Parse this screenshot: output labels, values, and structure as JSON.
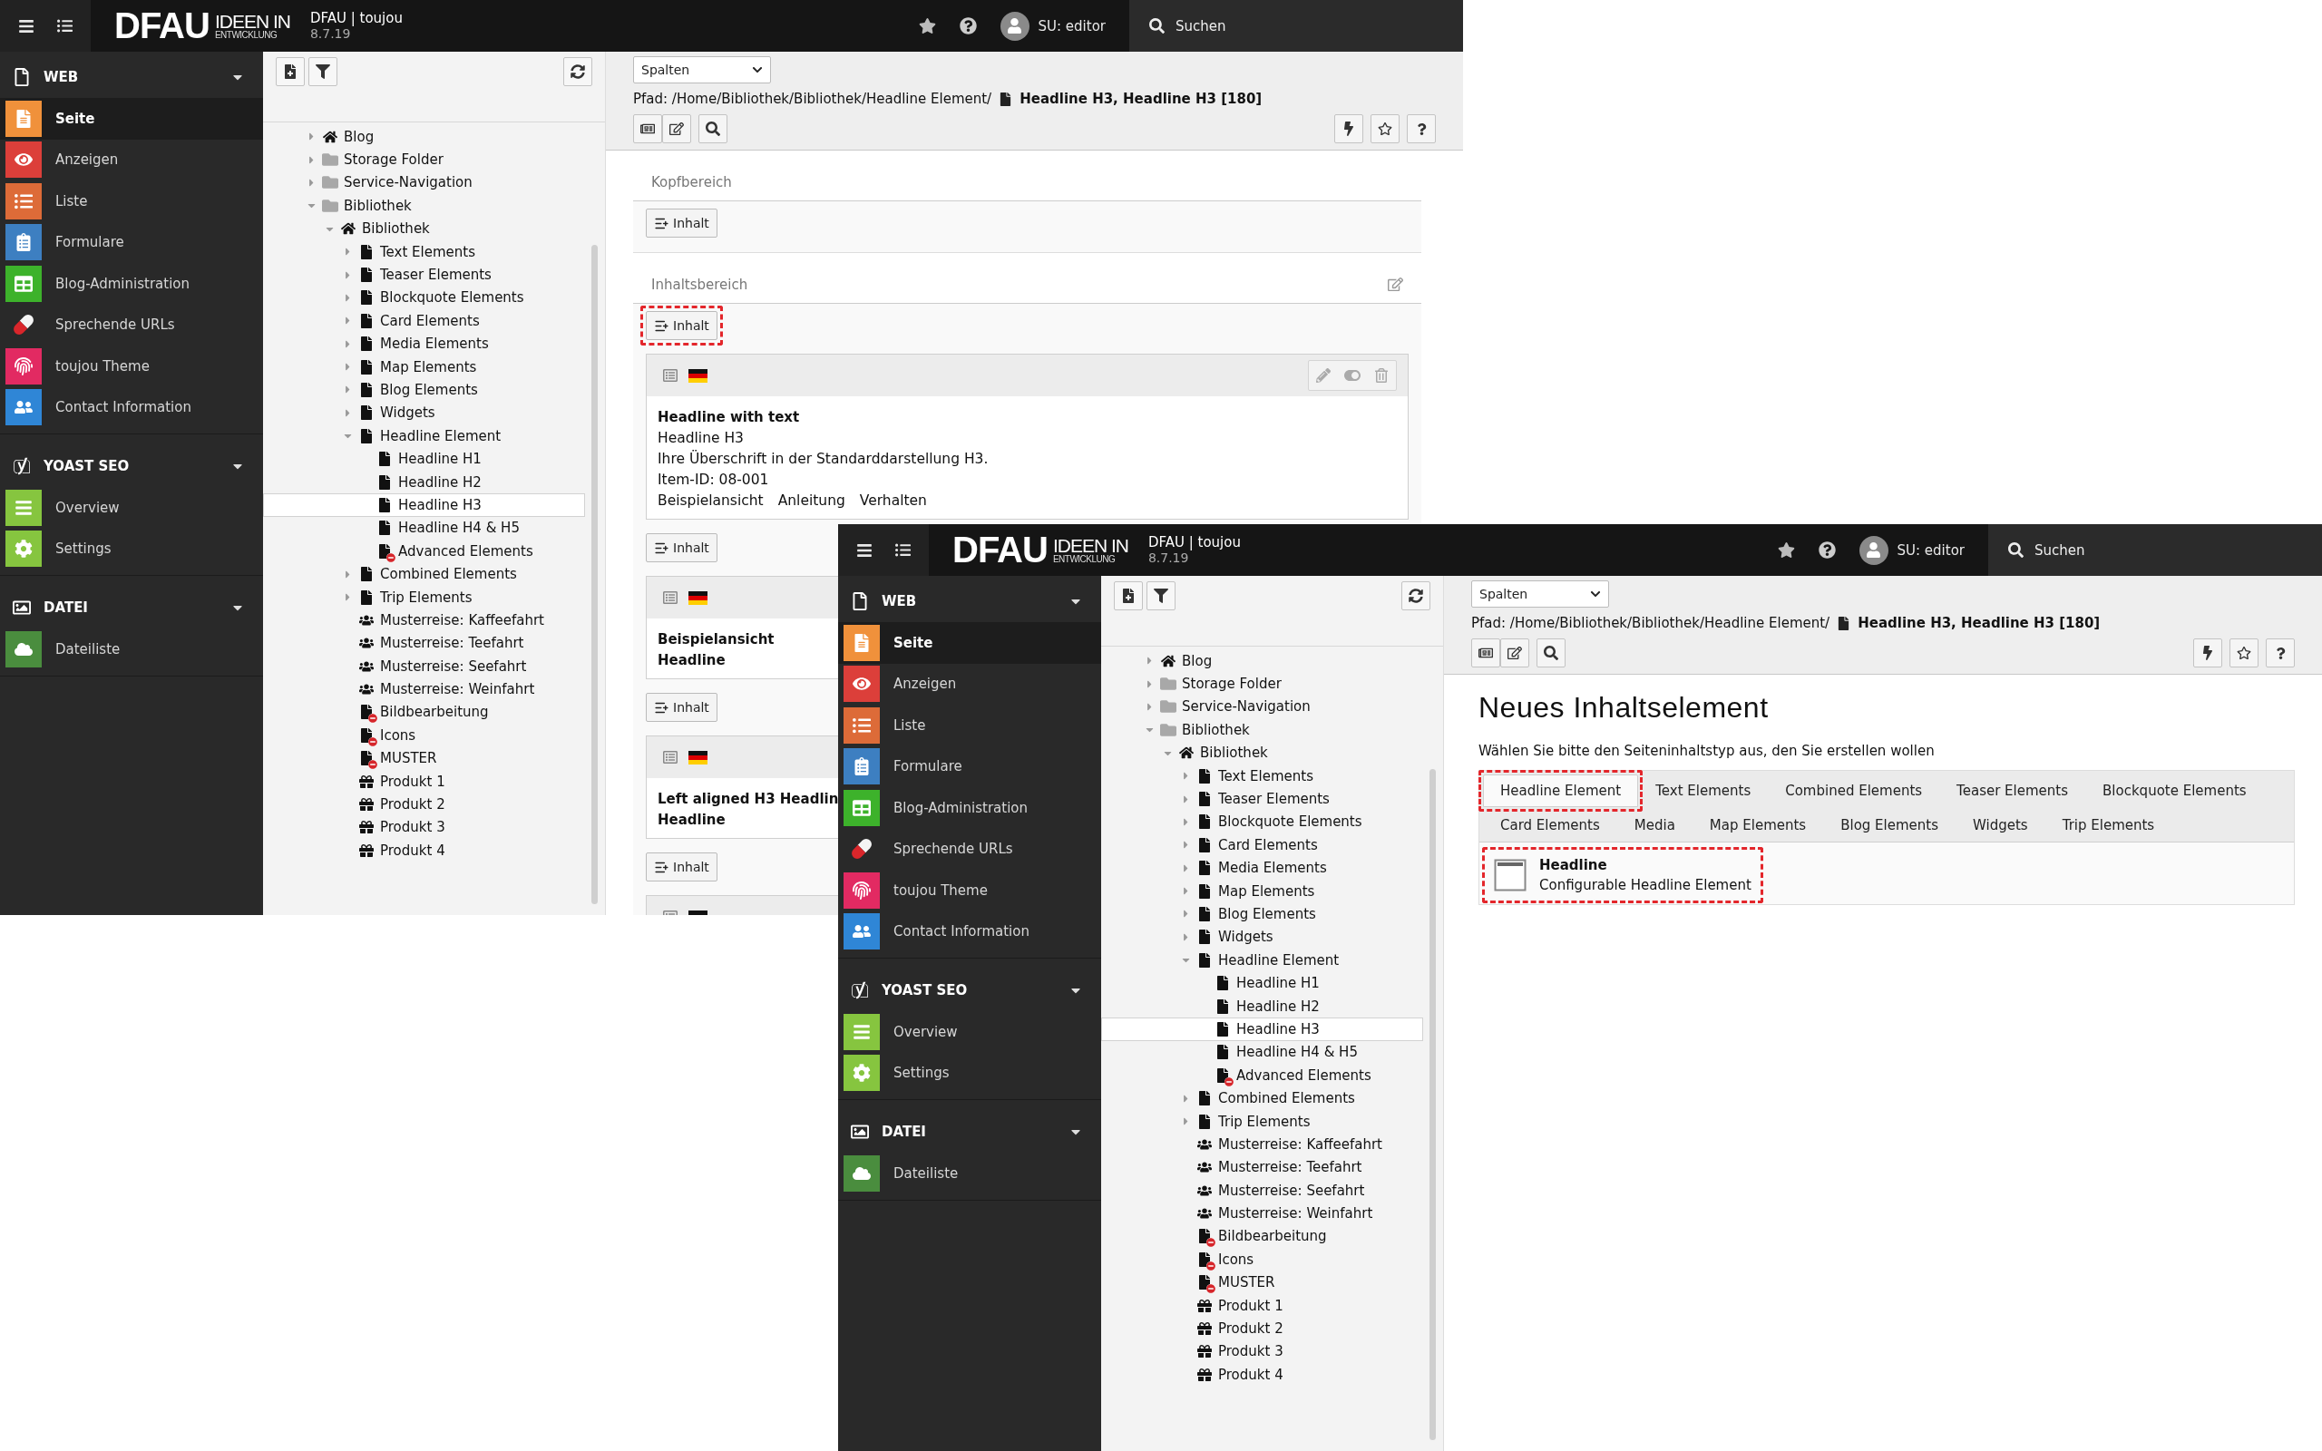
{
  "windows": [
    {
      "topbar": {
        "logo_main": "DFAU",
        "logo_top": "IDEEN IN",
        "logo_bottom": "ENTWICKLUNG",
        "site": "DFAU | toujou",
        "version": "8.7.19",
        "user": "SU: editor",
        "search": "Suchen"
      },
      "modules": [
        {
          "label": "WEB",
          "kind": "web",
          "expanded": true,
          "items": [
            {
              "label": "Seite",
              "kind": "page",
              "color": "#f0913b",
              "selected": true
            },
            {
              "label": "Anzeigen",
              "kind": "view",
              "color": "#dc3f3a",
              "selected": false
            },
            {
              "label": "Liste",
              "kind": "list",
              "color": "#dd6b38",
              "selected": false
            },
            {
              "label": "Formulare",
              "kind": "form",
              "color": "#3d7fc1",
              "selected": false
            },
            {
              "label": "Blog-Administration",
              "kind": "table",
              "color": "#3db22b",
              "selected": false
            },
            {
              "label": "Sprechende URLs",
              "kind": "pill",
              "selected": false
            },
            {
              "label": "toujou Theme",
              "kind": "fingerprint",
              "color": "#e22a62",
              "selected": false
            },
            {
              "label": "Contact Information",
              "kind": "contact",
              "color": "#2f86d6",
              "selected": false
            }
          ]
        },
        {
          "label": "YOAST SEO",
          "kind": "seo",
          "expanded": true,
          "items": [
            {
              "label": "Overview",
              "kind": "menu",
              "color": "#86c53f",
              "selected": false
            },
            {
              "label": "Settings",
              "kind": "gear",
              "color": "#86c53f",
              "selected": false
            }
          ]
        },
        {
          "label": "DATEI",
          "kind": "file",
          "expanded": true,
          "items": [
            {
              "label": "Dateiliste",
              "kind": "cloud",
              "color": "#4a8d3e",
              "selected": false
            }
          ]
        }
      ],
      "tree": [
        {
          "label": "Blog",
          "kind": "home",
          "expanded": false,
          "selected": false
        },
        {
          "label": "Storage Folder",
          "kind": "folder",
          "expanded": false,
          "selected": false
        },
        {
          "label": "Service-Navigation",
          "kind": "folder",
          "expanded": false,
          "selected": false
        },
        {
          "label": "Bibliothek",
          "kind": "folder",
          "expanded": true,
          "selected": false,
          "children": [
            {
              "label": "Bibliothek",
              "kind": "home",
              "expanded": true,
              "selected": false,
              "children": [
                {
                  "label": "Text Elements",
                  "kind": "page",
                  "expanded": false,
                  "selected": false
                },
                {
                  "label": "Teaser Elements",
                  "kind": "page",
                  "expanded": false,
                  "selected": false
                },
                {
                  "label": "Blockquote Elements",
                  "kind": "page",
                  "expanded": false,
                  "selected": false
                },
                {
                  "label": "Card Elements",
                  "kind": "page",
                  "expanded": false,
                  "selected": false
                },
                {
                  "label": "Media Elements",
                  "kind": "page",
                  "expanded": false,
                  "selected": false
                },
                {
                  "label": "Map Elements",
                  "kind": "page",
                  "expanded": false,
                  "selected": false
                },
                {
                  "label": "Blog Elements",
                  "kind": "page",
                  "expanded": false,
                  "selected": false
                },
                {
                  "label": "Widgets",
                  "kind": "page",
                  "expanded": false,
                  "selected": false
                },
                {
                  "label": "Headline Element",
                  "kind": "page",
                  "expanded": true,
                  "selected": false,
                  "children": [
                    {
                      "label": "Headline H1",
                      "kind": "page",
                      "selected": false
                    },
                    {
                      "label": "Headline H2",
                      "kind": "page",
                      "selected": false
                    },
                    {
                      "label": "Headline H3",
                      "kind": "page",
                      "selected": true
                    },
                    {
                      "label": "Headline H4 & H5",
                      "kind": "page",
                      "selected": false
                    },
                    {
                      "label": "Advanced Elements",
                      "kind": "hidden-page",
                      "selected": false
                    }
                  ]
                },
                {
                  "label": "Combined Elements",
                  "kind": "page",
                  "expanded": false,
                  "selected": false
                },
                {
                  "label": "Trip Elements",
                  "kind": "page",
                  "expanded": false,
                  "selected": false
                },
                {
                  "label": "Musterreise: Kaffeefahrt",
                  "kind": "group",
                  "selected": false
                },
                {
                  "label": "Musterreise: Teefahrt",
                  "kind": "group",
                  "selected": false
                },
                {
                  "label": "Musterreise: Seefahrt",
                  "kind": "group",
                  "selected": false
                },
                {
                  "label": "Musterreise: Weinfahrt",
                  "kind": "group",
                  "selected": false
                },
                {
                  "label": "Bildbearbeitung",
                  "kind": "hidden-page",
                  "selected": false
                },
                {
                  "label": "Icons",
                  "kind": "hidden-page",
                  "selected": false
                },
                {
                  "label": "MUSTER",
                  "kind": "hidden-page",
                  "selected": false
                },
                {
                  "label": "Produkt 1",
                  "kind": "gift",
                  "selected": false
                },
                {
                  "label": "Produkt 2",
                  "kind": "gift",
                  "selected": false
                },
                {
                  "label": "Produkt 3",
                  "kind": "gift",
                  "selected": false
                },
                {
                  "label": "Produkt 4",
                  "kind": "gift",
                  "selected": false
                }
              ]
            }
          ]
        }
      ],
      "docheader": {
        "select": "Spalten",
        "path": "Pfad: /Home/Bibliothek/Bibliothek/Headline Element/",
        "page": "Headline H3, Headline H3 [180]"
      },
      "content": {
        "kind": "page-layout",
        "sections": [
          {
            "title": "Kopfbereich",
            "editable": false,
            "items": [
              {
                "kind": "add-button",
                "label": "Inhalt",
                "highlighted": false
              }
            ]
          },
          {
            "title": "Inhaltsbereich",
            "editable": true,
            "items": [
              {
                "kind": "add-button",
                "label": "Inhalt",
                "highlighted": true
              },
              {
                "kind": "card",
                "toolbar": true,
                "heading": [
                  "Headline with text"
                ],
                "lines": [
                  "Headline H3",
                  "Ihre Überschrift in der Standarddarstellung H3.",
                  "Item-ID: 08-001"
                ],
                "links": [
                  "Beispielansicht",
                  "Anleitung",
                  "Verhalten"
                ]
              },
              {
                "kind": "add-button",
                "label": "Inhalt",
                "highlighted": false
              },
              {
                "kind": "card",
                "toolbar": false,
                "heading": [
                  "Beispielansicht",
                  "Headline"
                ]
              },
              {
                "kind": "add-button",
                "label": "Inhalt",
                "highlighted": false
              },
              {
                "kind": "card",
                "toolbar": false,
                "heading": [
                  "Left aligned H3 Headlin",
                  "Headline"
                ]
              },
              {
                "kind": "add-button",
                "label": "Inhalt",
                "highlighted": false
              },
              {
                "kind": "card",
                "toolbar": false
              }
            ]
          }
        ]
      }
    },
    {
      "topbar": {
        "logo_main": "DFAU",
        "logo_top": "IDEEN IN",
        "logo_bottom": "ENTWICKLUNG",
        "site": "DFAU | toujou",
        "version": "8.7.19",
        "user": "SU: editor",
        "search": "Suchen"
      },
      "modules": [
        {
          "label": "WEB",
          "kind": "web",
          "expanded": true,
          "items": [
            {
              "label": "Seite",
              "kind": "page",
              "color": "#f0913b",
              "selected": true
            },
            {
              "label": "Anzeigen",
              "kind": "view",
              "color": "#dc3f3a",
              "selected": false
            },
            {
              "label": "Liste",
              "kind": "list",
              "color": "#dd6b38",
              "selected": false
            },
            {
              "label": "Formulare",
              "kind": "form",
              "color": "#3d7fc1",
              "selected": false
            },
            {
              "label": "Blog-Administration",
              "kind": "table",
              "color": "#3db22b",
              "selected": false
            },
            {
              "label": "Sprechende URLs",
              "kind": "pill",
              "selected": false
            },
            {
              "label": "toujou Theme",
              "kind": "fingerprint",
              "color": "#e22a62",
              "selected": false
            },
            {
              "label": "Contact Information",
              "kind": "contact",
              "color": "#2f86d6",
              "selected": false
            }
          ]
        },
        {
          "label": "YOAST SEO",
          "kind": "seo",
          "expanded": true,
          "items": [
            {
              "label": "Overview",
              "kind": "menu",
              "color": "#86c53f",
              "selected": false
            },
            {
              "label": "Settings",
              "kind": "gear",
              "color": "#86c53f",
              "selected": false
            }
          ]
        },
        {
          "label": "DATEI",
          "kind": "file",
          "expanded": true,
          "items": [
            {
              "label": "Dateiliste",
              "kind": "cloud",
              "color": "#4a8d3e",
              "selected": false
            }
          ]
        }
      ],
      "tree": [
        {
          "label": "Blog",
          "kind": "home",
          "expanded": false,
          "selected": false
        },
        {
          "label": "Storage Folder",
          "kind": "folder",
          "expanded": false,
          "selected": false
        },
        {
          "label": "Service-Navigation",
          "kind": "folder",
          "expanded": false,
          "selected": false
        },
        {
          "label": "Bibliothek",
          "kind": "folder",
          "expanded": true,
          "selected": false,
          "children": [
            {
              "label": "Bibliothek",
              "kind": "home",
              "expanded": true,
              "selected": false,
              "children": [
                {
                  "label": "Text Elements",
                  "kind": "page",
                  "expanded": false,
                  "selected": false
                },
                {
                  "label": "Teaser Elements",
                  "kind": "page",
                  "expanded": false,
                  "selected": false
                },
                {
                  "label": "Blockquote Elements",
                  "kind": "page",
                  "expanded": false,
                  "selected": false
                },
                {
                  "label": "Card Elements",
                  "kind": "page",
                  "expanded": false,
                  "selected": false
                },
                {
                  "label": "Media Elements",
                  "kind": "page",
                  "expanded": false,
                  "selected": false
                },
                {
                  "label": "Map Elements",
                  "kind": "page",
                  "expanded": false,
                  "selected": false
                },
                {
                  "label": "Blog Elements",
                  "kind": "page",
                  "expanded": false,
                  "selected": false
                },
                {
                  "label": "Widgets",
                  "kind": "page",
                  "expanded": false,
                  "selected": false
                },
                {
                  "label": "Headline Element",
                  "kind": "page",
                  "expanded": true,
                  "selected": false,
                  "children": [
                    {
                      "label": "Headline H1",
                      "kind": "page",
                      "selected": false
                    },
                    {
                      "label": "Headline H2",
                      "kind": "page",
                      "selected": false
                    },
                    {
                      "label": "Headline H3",
                      "kind": "page",
                      "selected": true
                    },
                    {
                      "label": "Headline H4 & H5",
                      "kind": "page",
                      "selected": false
                    },
                    {
                      "label": "Advanced Elements",
                      "kind": "hidden-page",
                      "selected": false
                    }
                  ]
                },
                {
                  "label": "Combined Elements",
                  "kind": "page",
                  "expanded": false,
                  "selected": false
                },
                {
                  "label": "Trip Elements",
                  "kind": "page",
                  "expanded": false,
                  "selected": false
                },
                {
                  "label": "Musterreise: Kaffeefahrt",
                  "kind": "group",
                  "selected": false
                },
                {
                  "label": "Musterreise: Teefahrt",
                  "kind": "group",
                  "selected": false
                },
                {
                  "label": "Musterreise: Seefahrt",
                  "kind": "group",
                  "selected": false
                },
                {
                  "label": "Musterreise: Weinfahrt",
                  "kind": "group",
                  "selected": false
                },
                {
                  "label": "Bildbearbeitung",
                  "kind": "hidden-page",
                  "selected": false
                },
                {
                  "label": "Icons",
                  "kind": "hidden-page",
                  "selected": false
                },
                {
                  "label": "MUSTER",
                  "kind": "hidden-page",
                  "selected": false
                },
                {
                  "label": "Produkt 1",
                  "kind": "gift",
                  "selected": false
                },
                {
                  "label": "Produkt 2",
                  "kind": "gift",
                  "selected": false
                },
                {
                  "label": "Produkt 3",
                  "kind": "gift",
                  "selected": false
                },
                {
                  "label": "Produkt 4",
                  "kind": "gift",
                  "selected": false
                }
              ]
            }
          ]
        }
      ],
      "docheader": {
        "select": "Spalten",
        "path": "Pfad: /Home/Bibliothek/Bibliothek/Headline Element/",
        "page": "Headline H3, Headline H3 [180]"
      },
      "content": {
        "kind": "new-content-wizard",
        "title": "Neues Inhaltselement",
        "intro": "Wählen Sie bitte den Seiteninhaltstyp aus, den Sie erstellen wollen",
        "tabs": [
          {
            "label": "Headline Element",
            "selected": true,
            "highlighted": true
          },
          {
            "label": "Text Elements",
            "selected": false,
            "highlighted": false
          },
          {
            "label": "Combined Elements",
            "selected": false,
            "highlighted": false
          },
          {
            "label": "Teaser Elements",
            "selected": false,
            "highlighted": false
          },
          {
            "label": "Blockquote Elements",
            "selected": false,
            "highlighted": false
          },
          {
            "label": "Card Elements",
            "selected": false,
            "highlighted": false
          },
          {
            "label": "Media",
            "selected": false,
            "highlighted": false
          },
          {
            "label": "Map Elements",
            "selected": false,
            "highlighted": false
          },
          {
            "label": "Blog Elements",
            "selected": false,
            "highlighted": false
          },
          {
            "label": "Widgets",
            "selected": false,
            "highlighted": false
          },
          {
            "label": "Trip Elements",
            "selected": false,
            "highlighted": false
          }
        ],
        "elements": [
          {
            "title": "Headline",
            "description": "Configurable Headline Element",
            "highlighted": true
          }
        ]
      }
    }
  ]
}
